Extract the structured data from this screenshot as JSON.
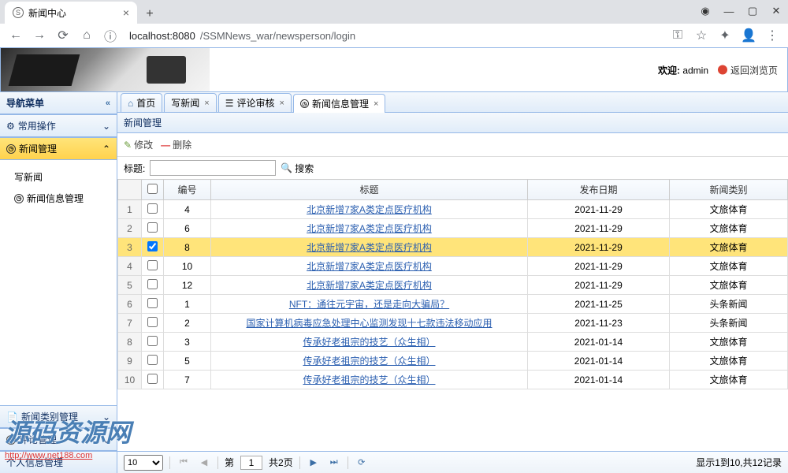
{
  "browser": {
    "tab_title": "新闻中心",
    "url_host": "localhost",
    "url_port": ":8080",
    "url_path": "/SSMNews_war/newsperson/login"
  },
  "banner": {
    "welcome_label": "欢迎:",
    "username": "admin",
    "back_label": "返回浏览页"
  },
  "sidebar": {
    "title": "导航菜单",
    "panels": {
      "common": "常用操作",
      "news": "新闻管理",
      "category": "新闻类别管理",
      "comment": "评论管理",
      "personal": "个人信息管理"
    },
    "items": {
      "write": "写新闻",
      "info": "新闻信息管理"
    }
  },
  "tabs": {
    "home": "首页",
    "write": "写新闻",
    "review": "评论审核",
    "info": "新闻信息管理"
  },
  "panel": {
    "title": "新闻管理",
    "edit": "修改",
    "delete": "删除",
    "search_label": "标题:",
    "search_btn": "搜索"
  },
  "table": {
    "headers": {
      "id": "编号",
      "title": "标题",
      "date": "发布日期",
      "cat": "新闻类别"
    },
    "rows": [
      {
        "n": "1",
        "id": "4",
        "title": "北京新增7家A类定点医疗机构",
        "date": "2021-11-29",
        "cat": "文旅体育",
        "sel": false
      },
      {
        "n": "2",
        "id": "6",
        "title": "北京新增7家A类定点医疗机构",
        "date": "2021-11-29",
        "cat": "文旅体育",
        "sel": false
      },
      {
        "n": "3",
        "id": "8",
        "title": "北京新增7家A类定点医疗机构",
        "date": "2021-11-29",
        "cat": "文旅体育",
        "sel": true
      },
      {
        "n": "4",
        "id": "10",
        "title": "北京新增7家A类定点医疗机构",
        "date": "2021-11-29",
        "cat": "文旅体育",
        "sel": false
      },
      {
        "n": "5",
        "id": "12",
        "title": "北京新增7家A类定点医疗机构",
        "date": "2021-11-29",
        "cat": "文旅体育",
        "sel": false
      },
      {
        "n": "6",
        "id": "1",
        "title": "NFT：通往元宇宙，还是走向大骗局？",
        "date": "2021-11-25",
        "cat": "头条新闻",
        "sel": false
      },
      {
        "n": "7",
        "id": "2",
        "title": "国家计算机病毒应急处理中心监测发现十七款违法移动应用",
        "date": "2021-11-23",
        "cat": "头条新闻",
        "sel": false
      },
      {
        "n": "8",
        "id": "3",
        "title": "传承好老祖宗的技艺（众生相）",
        "date": "2021-01-14",
        "cat": "文旅体育",
        "sel": false
      },
      {
        "n": "9",
        "id": "5",
        "title": "传承好老祖宗的技艺（众生相）",
        "date": "2021-01-14",
        "cat": "文旅体育",
        "sel": false
      },
      {
        "n": "10",
        "id": "7",
        "title": "传承好老祖宗的技艺（众生相）",
        "date": "2021-01-14",
        "cat": "文旅体育",
        "sel": false
      }
    ]
  },
  "pager": {
    "page_label_pre": "第",
    "page": "1",
    "total_pages": "共2页",
    "info": "显示1到10,共12记录"
  },
  "watermark": {
    "text": "源码资源网",
    "url": "http://www.net188.com"
  }
}
